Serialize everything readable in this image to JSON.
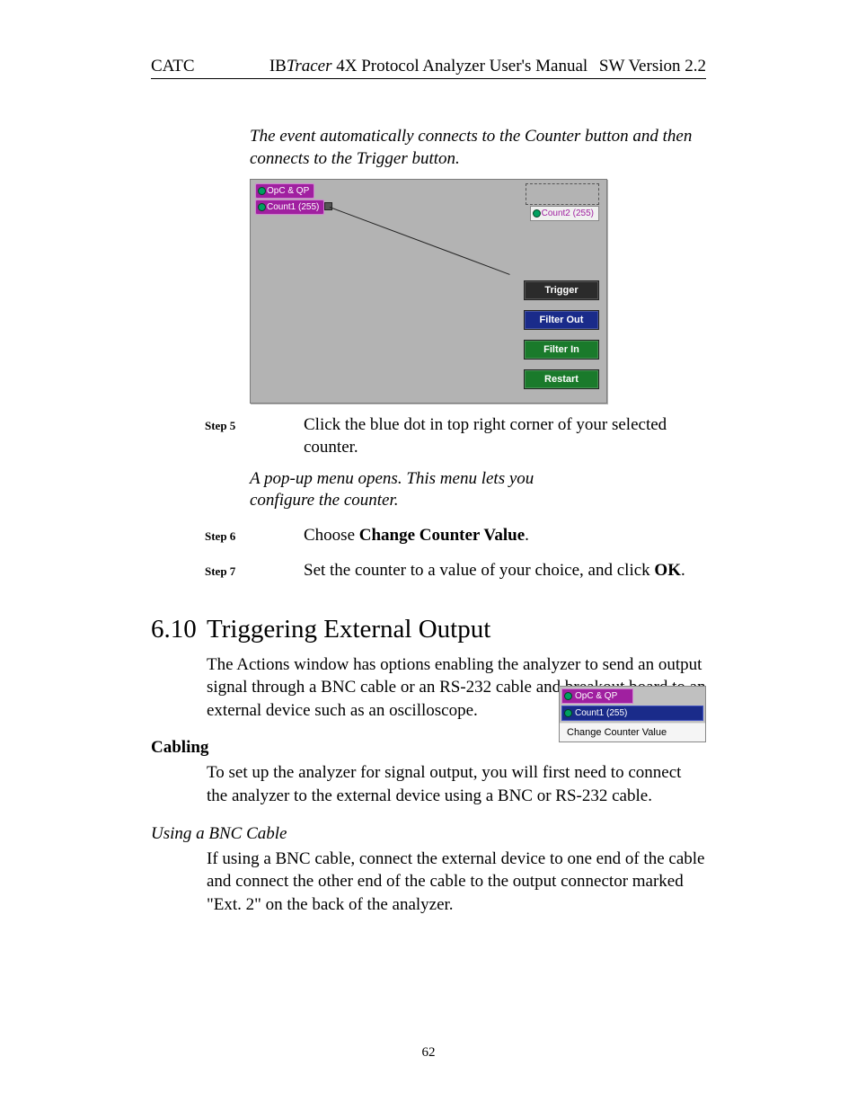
{
  "header": {
    "left": "CATC",
    "center_prefix": "IB",
    "center_italic": "Tracer",
    "center_suffix": " 4X Protocol Analyzer User's Manual",
    "right": "SW Version 2.2"
  },
  "intro_italic": "The event automatically connects to the Counter button and then connects to the Trigger button.",
  "diagram1": {
    "opc": "OpC & QP",
    "count1": "Count1 (255)",
    "count2": "Count2 (255)",
    "trigger": "Trigger",
    "filter_out": "Filter Out",
    "filter_in": "Filter In",
    "restart": "Restart"
  },
  "steps": {
    "s5_label": "Step 5",
    "s5_text": "Click the blue dot in top right corner of your selected counter.",
    "s5_sub_italic": "A pop-up menu opens. This menu lets you configure the counter.",
    "s6_label": "Step 6",
    "s6_prefix": "Choose ",
    "s6_bold": "Change Counter Value",
    "s6_suffix": ".",
    "s7_label": "Step 7",
    "s7_prefix": "Set the counter to a value of your choice, and click ",
    "s7_bold": "OK",
    "s7_suffix": "."
  },
  "popup": {
    "opc": "OpC & QP",
    "count1": "Count1 (255)",
    "change": "Change Counter Value"
  },
  "section": {
    "num": "6.10",
    "title": "Triggering External Output",
    "para1": "The Actions window has options enabling the analyzer to send an output signal through a BNC cable or an RS-232 cable and breakout board to an external device such as an oscilloscope.",
    "cabling": "Cabling",
    "cabling_para": "To set up the analyzer for signal output, you will first need to connect the analyzer to the external device using a BNC or RS-232 cable.",
    "bnc_head": "Using a BNC Cable",
    "bnc_para": "If using a BNC cable, connect the external device to one end of the cable and connect the other end of the cable to the output connector marked \"Ext. 2\" on the back of the analyzer."
  },
  "page_number": "62"
}
